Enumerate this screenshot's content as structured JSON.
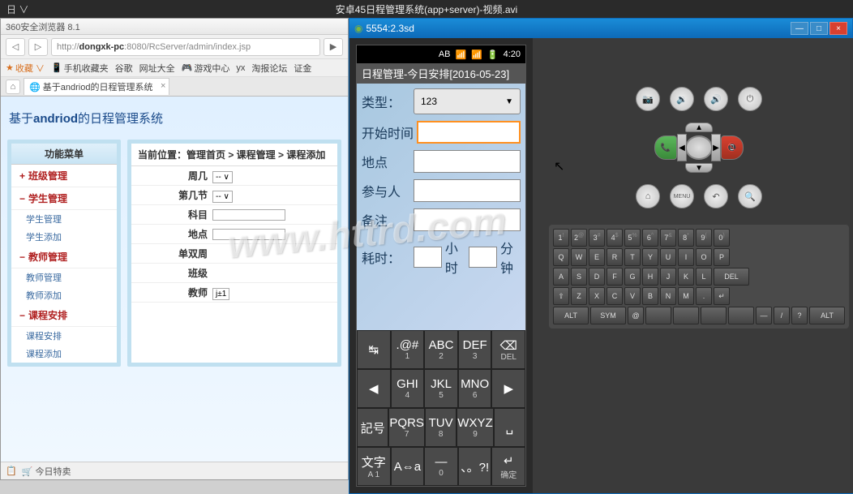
{
  "topbar": {
    "menu": "日 ∨",
    "title": "安卓45日程管理系统(app+server)-视频.avi"
  },
  "browser": {
    "title": "360安全浏览器 8.1",
    "url_prefix": "http://",
    "url_host": "dongxk-pc",
    "url_path": ":8080/RcServer/admin/index.jsp",
    "bookmarks": {
      "fav": "收藏 ∨",
      "mob": "手机收藏夹",
      "g": "谷歌",
      "wz": "网址大全",
      "yx": "游戏中心",
      "bm_yx": "yx",
      "tb": "淘报论坛",
      "zj": "证金"
    },
    "tab": {
      "label": "基于andriod的日程管理系统",
      "close": "×"
    },
    "page_header_1": "基于",
    "page_header_2": "andriod",
    "page_header_3": "的日程管理系统",
    "sidebar": {
      "title": "功能菜单",
      "items": [
        {
          "label": "班级管理",
          "state": "collapsed"
        },
        {
          "label": "学生管理",
          "state": "expanded",
          "subs": [
            "学生管理",
            "学生添加"
          ]
        },
        {
          "label": "教师管理",
          "state": "expanded",
          "subs": [
            "教师管理",
            "教师添加"
          ]
        },
        {
          "label": "课程安排",
          "state": "expanded",
          "subs": [
            "课程安排",
            "课程添加"
          ]
        }
      ]
    },
    "main": {
      "breadcrumb": "当前位置：管理首页 > 课程管理 > 课程添加",
      "fields": [
        "周几",
        "第几节",
        "科目",
        "地点",
        "单双周",
        "班级",
        "教师"
      ],
      "selects": {
        "zhou": "-- ∨",
        "jie": "-- ∨",
        "jiaoshi": "j±1"
      }
    },
    "status": {
      "today": "今日特卖"
    }
  },
  "emulator": {
    "title": "5554:2.3sd",
    "android": {
      "status": {
        "ab": "AB",
        "time": "4:20"
      },
      "title": "日程管理-今日安排[2016-05-23]",
      "form": {
        "type_label": "类型：",
        "type_value": "123",
        "start_label": "开始时间",
        "place_label": "地点",
        "attend_label": "参与人",
        "note_label": "备注",
        "duration_label": "耗时：",
        "hours": "小时",
        "minutes": "分钟"
      },
      "keyboard": {
        "r1": [
          {
            "m": "↹"
          },
          {
            "m": ".@#",
            "s": "1"
          },
          {
            "m": "ABC",
            "s": "2"
          },
          {
            "m": "DEF",
            "s": "3"
          },
          {
            "m": "⌫",
            "s": "DEL"
          }
        ],
        "r2": [
          {
            "m": "◀"
          },
          {
            "m": "GHI",
            "s": "4"
          },
          {
            "m": "JKL",
            "s": "5"
          },
          {
            "m": "MNO",
            "s": "6"
          },
          {
            "m": "▶"
          }
        ],
        "r3": [
          {
            "m": "記号"
          },
          {
            "m": "PQRS",
            "s": "7"
          },
          {
            "m": "TUV",
            "s": "8"
          },
          {
            "m": "WXYZ",
            "s": "9"
          },
          {
            "m": "␣"
          }
        ],
        "r4": [
          {
            "m": "文字",
            "s": "A 1"
          },
          {
            "m": "A⇔a"
          },
          {
            "m": "—",
            "s": "0"
          },
          {
            "m": "、。?!"
          },
          {
            "m": "↵",
            "s": "确定"
          }
        ]
      }
    },
    "controls": {
      "r1": [
        "📷",
        "🔉",
        "🔊",
        "⏻"
      ],
      "r3": [
        "⌂",
        "MENU",
        "↶",
        "🔍"
      ]
    },
    "hw_keyboard": {
      "r1": [
        "1",
        "2",
        "3",
        "4",
        "5",
        "6",
        "7",
        "8",
        "9",
        "0"
      ],
      "r1s": [
        "!",
        "@",
        "#",
        "$",
        "%",
        "^",
        "&",
        "*",
        "(",
        ")"
      ],
      "r2": [
        "Q",
        "W",
        "E",
        "R",
        "T",
        "Y",
        "U",
        "I",
        "O",
        "P"
      ],
      "r3": [
        "A",
        "S",
        "D",
        "F",
        "G",
        "H",
        "J",
        "K",
        "L",
        "DEL"
      ],
      "r4": [
        "⇧",
        "Z",
        "X",
        "C",
        "V",
        "B",
        "N",
        "M",
        ".",
        "↵"
      ],
      "r5": [
        "ALT",
        "SYM",
        "@",
        "",
        "",
        "",
        "",
        "—",
        "/",
        "?",
        "ALT"
      ]
    }
  },
  "watermark": "www.httrd.com"
}
